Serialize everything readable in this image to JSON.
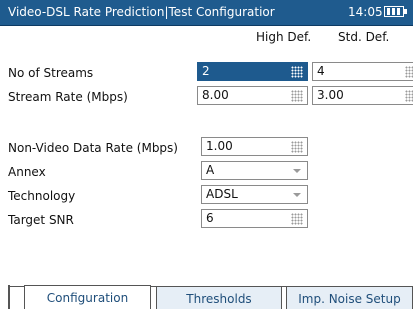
{
  "titlebar": {
    "title": "Video-DSL Rate Prediction|Test Configuratior",
    "time": "14:05"
  },
  "columns": {
    "high": "High Def.",
    "std": "Std. Def."
  },
  "rows": {
    "streams": {
      "label": "No of Streams",
      "high": "2",
      "std": "4"
    },
    "rate": {
      "label": "Stream Rate (Mbps)",
      "high": "8.00",
      "std": "3.00"
    }
  },
  "settings": {
    "nonvideo": {
      "label": "Non-Video Data Rate (Mbps)",
      "value": "1.00"
    },
    "annex": {
      "label": "Annex",
      "value": "A"
    },
    "technology": {
      "label": "Technology",
      "value": "ADSL"
    },
    "snr": {
      "label": "Target SNR",
      "value": "6"
    }
  },
  "tabs": [
    "Configuration",
    "Thresholds",
    "Imp. Noise Setup"
  ],
  "icons": {
    "battery": "battery-icon",
    "keypad": "keypad-icon",
    "dropdown": "dropdown-arrow-icon"
  },
  "colors": {
    "titlebar": "#1f5b8e",
    "selected": "#1e5a8e",
    "tab_text": "#1f4e7a"
  }
}
